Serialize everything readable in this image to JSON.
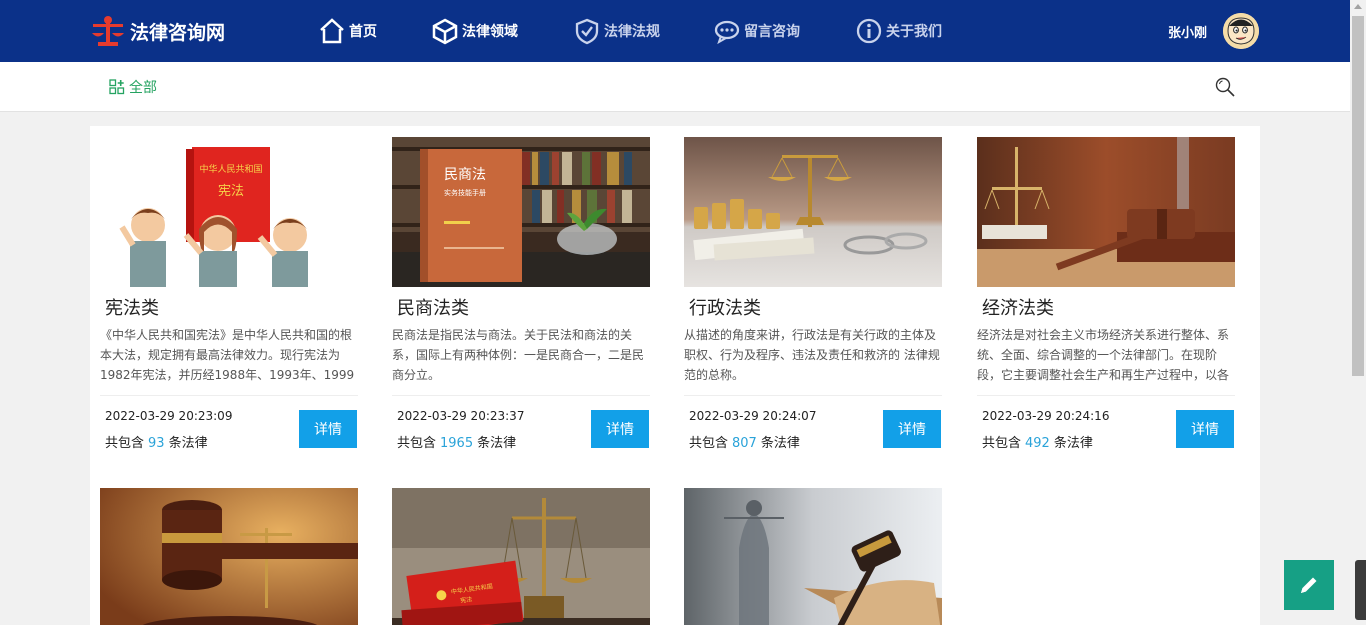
{
  "brand": {
    "name": "法律咨询网"
  },
  "nav": [
    {
      "label": "首页",
      "icon": "home-icon"
    },
    {
      "label": "法律领域",
      "icon": "cube-icon"
    },
    {
      "label": "法律法规",
      "icon": "shield-check-icon"
    },
    {
      "label": "留言咨询",
      "icon": "chat-bubble-icon"
    },
    {
      "label": "关于我们",
      "icon": "info-icon"
    }
  ],
  "user": {
    "name": "张小刚"
  },
  "filter": {
    "all_label": "全部"
  },
  "cards": [
    {
      "title": "宪法类",
      "desc": "《中华人民共和国宪法》是中华人民共和国的根本大法，规定拥有最高法律效力。现行宪法为1982年宪法，并历经1988年、1993年、1999",
      "date": "2022-03-29 20:23:09",
      "count_prefix": "共包含",
      "count": "93",
      "count_suffix": "条法律",
      "button": "详情",
      "image": "constitution-cartoon"
    },
    {
      "title": "民商法类",
      "desc": "民商法是指民法与商法。关于民法和商法的关系，国际上有两种体例：一是民商合一，二是民商分立。",
      "date": "2022-03-29 20:23:37",
      "count_prefix": "共包含",
      "count": "1965",
      "count_suffix": "条法律",
      "button": "详情",
      "image": "civil-law-book",
      "book_title": "民商法",
      "book_sub": "实务技能手册"
    },
    {
      "title": "行政法类",
      "desc": "从描述的角度来讲，行政法是有关行政的主体及职权、行为及程序、违法及责任和救济的 法律规范的总称。",
      "date": "2022-03-29 20:24:07",
      "count_prefix": "共包含",
      "count": "807",
      "count_suffix": "条法律",
      "button": "详情",
      "image": "scale-coins"
    },
    {
      "title": "经济法类",
      "desc": "经济法是对社会主义市场经济关系进行整体、系统、全面、综合调整的一个法律部门。在现阶段，它主要调整社会生产和再生产过程中，以各",
      "date": "2022-03-29 20:24:16",
      "count_prefix": "共包含",
      "count": "492",
      "count_suffix": "条法律",
      "button": "详情",
      "image": "gavel-scale"
    },
    {
      "image": "gavel-closeup"
    },
    {
      "image": "red-book-scale",
      "book_title": "中华人民共和国",
      "book_sub": "宪法"
    },
    {
      "image": "justice-statue"
    }
  ],
  "constitution_book": {
    "line1": "中华人民共和国",
    "line2": "宪法"
  },
  "colors": {
    "nav_bg": "#0b3189",
    "accent": "#12a0e8",
    "green": "#25a361",
    "fab": "#16a085"
  }
}
